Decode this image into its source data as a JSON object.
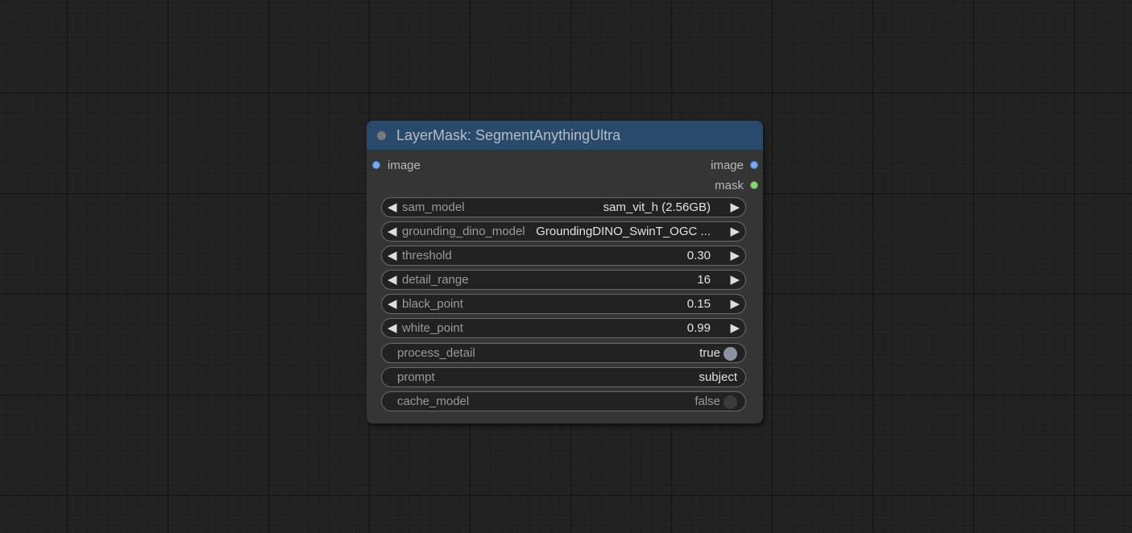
{
  "node": {
    "title": "LayerMask: SegmentAnythingUltra",
    "inputs": [
      {
        "label": "image",
        "type_color": "#7aa8ee"
      }
    ],
    "outputs": [
      {
        "label": "image",
        "type_color": "#7aa8ee"
      },
      {
        "label": "mask",
        "type_color": "#8fd27e"
      }
    ],
    "widgets": {
      "sam_model": {
        "label": "sam_model",
        "value": "sam_vit_h (2.56GB)"
      },
      "grounding_dino_model": {
        "label": "grounding_dino_model",
        "value": "GroundingDINO_SwinT_OGC ..."
      },
      "threshold": {
        "label": "threshold",
        "value": "0.30"
      },
      "detail_range": {
        "label": "detail_range",
        "value": "16"
      },
      "black_point": {
        "label": "black_point",
        "value": "0.15"
      },
      "white_point": {
        "label": "white_point",
        "value": "0.99"
      },
      "process_detail": {
        "label": "process_detail",
        "value": "true"
      },
      "prompt": {
        "label": "prompt",
        "value": "subject"
      },
      "cache_model": {
        "label": "cache_model",
        "value": "false"
      }
    },
    "arrow_left": "◀",
    "arrow_right": "▶"
  },
  "colors": {
    "canvas_bg": "#222222",
    "node_bg": "#353535",
    "title_bg": "#2a4a6c",
    "widget_bg": "#222222"
  }
}
